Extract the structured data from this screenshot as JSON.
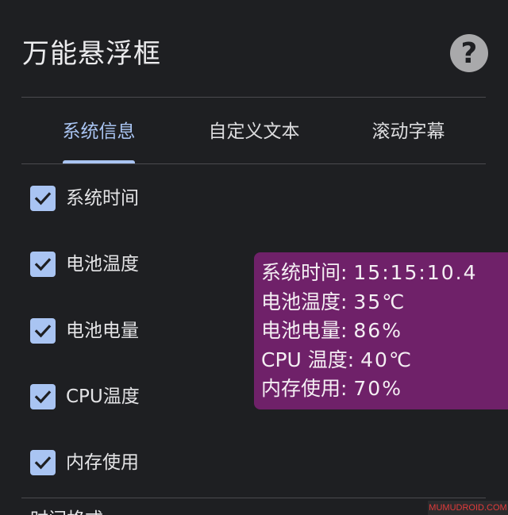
{
  "header": {
    "title": "万能悬浮框",
    "help_glyph": "?"
  },
  "tabs": [
    {
      "label": "系统信息",
      "active": true
    },
    {
      "label": "自定义文本",
      "active": false
    },
    {
      "label": "滚动字幕",
      "active": false
    }
  ],
  "options": [
    {
      "label": "系统时间",
      "checked": true
    },
    {
      "label": "电池温度",
      "checked": true
    },
    {
      "label": "电池电量",
      "checked": true
    },
    {
      "label": "CPU温度",
      "checked": true
    },
    {
      "label": "内存使用",
      "checked": true
    }
  ],
  "overlay": {
    "lines": [
      {
        "label": "系统时间:",
        "value": "15:15:10.4"
      },
      {
        "label": "电池温度:",
        "value": "35℃"
      },
      {
        "label": "电池电量:",
        "value": "86%"
      },
      {
        "label": "CPU 温度:",
        "value": "40℃"
      },
      {
        "label": "内存使用:",
        "value": "70%"
      }
    ]
  },
  "next_section": {
    "label": "时间格式"
  },
  "watermark": "MUMUDROID.COM",
  "colors": {
    "background": "#1e1f22",
    "accent": "#a9c4f2",
    "overlay_bg": "#6f2169",
    "help_bg": "#a9a9ab",
    "divider": "#4a4a4e",
    "watermark_text": "#e23b3b"
  },
  "icons": {
    "help": "help-circle-icon",
    "check": "checkmark-icon"
  }
}
